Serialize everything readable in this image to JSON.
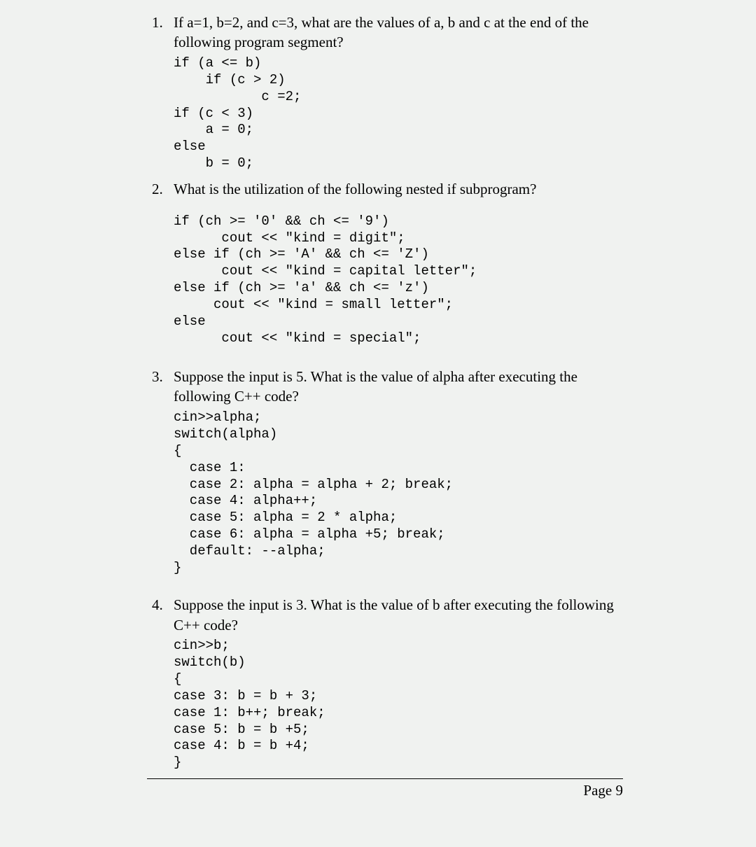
{
  "questions": [
    {
      "prompt": "If a=1, b=2, and c=3, what are the values of a, b and c at the end of the following program segment?",
      "code": "if (a <= b)\n    if (c > 2)\n           c =2;\nif (c < 3)\n    a = 0;\nelse\n    b = 0;"
    },
    {
      "prompt": "What is the utilization of the following nested if subprogram?",
      "code": "if (ch >= '0' && ch <= '9')\n      cout << \"kind = digit\";\nelse if (ch >= 'A' && ch <= 'Z')\n      cout << \"kind = capital letter\";\nelse if (ch >= 'a' && ch <= 'z')\n     cout << \"kind = small letter\";\nelse\n      cout << \"kind = special\";"
    },
    {
      "prompt": "Suppose the input is 5. What is the value of alpha after executing the following C++ code?",
      "code": "cin>>alpha;\nswitch(alpha)\n{\n  case 1:\n  case 2: alpha = alpha + 2; break;\n  case 4: alpha++;\n  case 5: alpha = 2 * alpha;\n  case 6: alpha = alpha +5; break;\n  default: --alpha;\n}"
    },
    {
      "prompt": "Suppose the input is 3. What is the value of b after executing the following C++ code?",
      "code": "cin>>b;\nswitch(b)\n{\ncase 3: b = b + 3;\ncase 1: b++; break;\ncase 5: b = b +5;\ncase 4: b = b +4;\n}"
    }
  ],
  "page_label": "Page 9"
}
